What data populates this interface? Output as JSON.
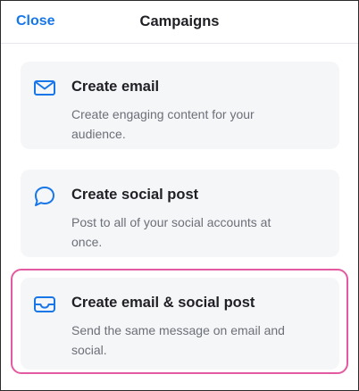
{
  "header": {
    "close_label": "Close",
    "title": "Campaigns"
  },
  "options": [
    {
      "title": "Create email",
      "description": "Create engaging content for your audience.",
      "icon": "envelope-icon"
    },
    {
      "title": "Create social post",
      "description": "Post to all of your social accounts at once.",
      "icon": "speech-bubble-icon"
    },
    {
      "title": "Create email & social post",
      "description": "Send the same message on email and social.",
      "icon": "inbox-icon"
    }
  ],
  "colors": {
    "accent": "#1877e8",
    "highlight": "#e45aa0",
    "card_background": "#f5f6f8"
  }
}
